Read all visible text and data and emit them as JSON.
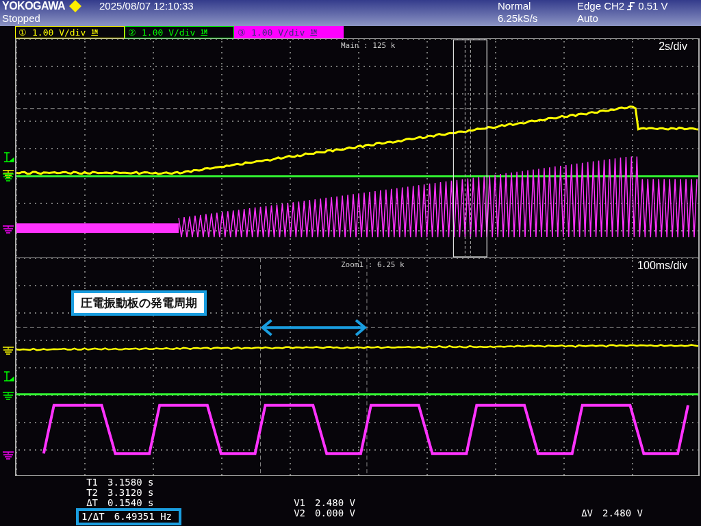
{
  "header": {
    "brand": "YOKOGAWA",
    "datetime": "2025/08/07 12:10:33",
    "status": "Stopped",
    "acquisition_mode": "Normal",
    "sample_rate": "6.25kS/s",
    "trigger": "Edge CH2",
    "trigger_level": "0.51 V",
    "trigger_mode": "Auto"
  },
  "channels": [
    {
      "label": "①",
      "scale": "1.00 V/div",
      "coupling": "1M",
      "color": "#ffff00",
      "selected": false
    },
    {
      "label": "②",
      "scale": "1.00 V/div",
      "coupling": "1M",
      "color": "#00ff00",
      "selected": false
    },
    {
      "label": "③",
      "scale": "1.00 V/div",
      "coupling": "1M",
      "color": "#ff00ff",
      "selected": true
    }
  ],
  "main_window": {
    "label": "Main : 125 k",
    "timebase": "2s/div"
  },
  "zoom_window": {
    "label": "Zoom1 : 6.25 k",
    "timebase": "100ms/div"
  },
  "annotation": {
    "text": "圧電振動板の発電周期"
  },
  "measurements": {
    "time": [
      {
        "name": "T1",
        "value": "3.1580 s",
        "highlighted": false
      },
      {
        "name": "T2",
        "value": "3.3120 s",
        "highlighted": false
      },
      {
        "name": "ΔT",
        "value": "0.1540 s",
        "highlighted": false
      },
      {
        "name": "1/ΔT",
        "value": "6.49351 Hz",
        "highlighted": true
      }
    ],
    "voltage": [
      {
        "name": "V1",
        "value": "2.480 V"
      },
      {
        "name": "V2",
        "value": "0.000 V"
      }
    ],
    "delta_v": {
      "name": "ΔV",
      "value": "2.480 V"
    }
  }
}
